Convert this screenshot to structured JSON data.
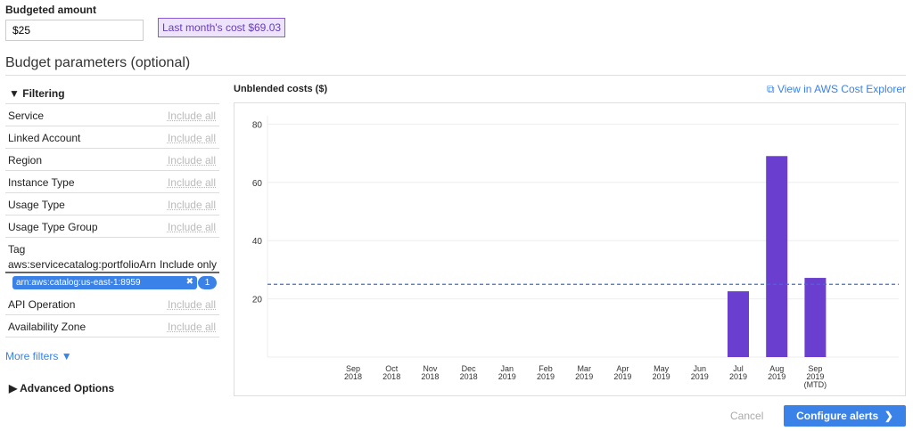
{
  "budget": {
    "label": "Budgeted amount",
    "value": "$25",
    "last_month": "Last month's cost $69.03"
  },
  "params_title": "Budget parameters (optional)",
  "filtering": {
    "title": "Filtering",
    "rows": [
      {
        "name": "Service",
        "value": "Include all"
      },
      {
        "name": "Linked Account",
        "value": "Include all"
      },
      {
        "name": "Region",
        "value": "Include all"
      },
      {
        "name": "Instance Type",
        "value": "Include all"
      },
      {
        "name": "Usage Type",
        "value": "Include all"
      },
      {
        "name": "Usage Type Group",
        "value": "Include all"
      }
    ],
    "tag": {
      "name": "Tag",
      "key": "aws:servicecatalog:portfolioArn",
      "mode": "Include only",
      "chip": "arn:aws:catalog:us-east-1:8959",
      "chip_remove": "✖",
      "count": "1"
    },
    "rows2": [
      {
        "name": "API Operation",
        "value": "Include all"
      },
      {
        "name": "Availability Zone",
        "value": "Include all"
      }
    ],
    "more": "More filters"
  },
  "advanced": "Advanced Options",
  "chart_header": {
    "title": "Unblended costs ($)",
    "link": "View in AWS Cost Explorer"
  },
  "chart_data": {
    "type": "bar",
    "title": "Unblended costs ($)",
    "categories": [
      [
        "Sep",
        "2018"
      ],
      [
        "Oct",
        "2018"
      ],
      [
        "Nov",
        "2018"
      ],
      [
        "Dec",
        "2018"
      ],
      [
        "Jan",
        "2019"
      ],
      [
        "Feb",
        "2019"
      ],
      [
        "Mar",
        "2019"
      ],
      [
        "Apr",
        "2019"
      ],
      [
        "May",
        "2019"
      ],
      [
        "Jun",
        "2019"
      ],
      [
        "Jul",
        "2019"
      ],
      [
        "Aug",
        "2019"
      ],
      [
        "Sep",
        "2019",
        "(MTD)"
      ]
    ],
    "values": [
      0,
      0,
      0,
      0,
      0,
      0,
      0,
      0,
      0,
      0,
      22.6,
      69.03,
      27.2
    ],
    "budget_line": 25,
    "ylim": [
      0,
      80
    ],
    "yticks": [
      20,
      40,
      60,
      80
    ],
    "bar_color": "#6a3fd0",
    "line_color": "#3b6fd8"
  },
  "footer": {
    "cancel": "Cancel",
    "configure": "Configure alerts"
  }
}
